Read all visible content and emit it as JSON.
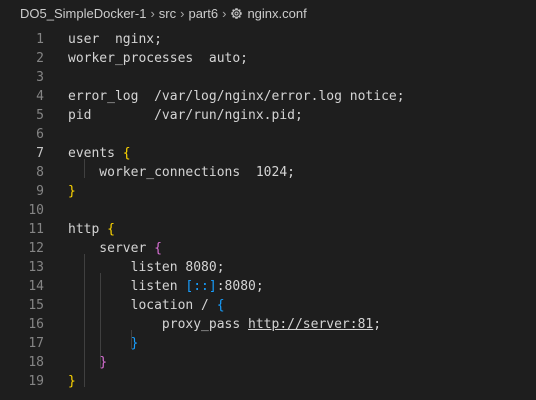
{
  "breadcrumb": {
    "items": [
      "DO5_SimpleDocker-1",
      "src",
      "part6"
    ],
    "file_name": "nginx.conf",
    "file_icon": "gear-icon",
    "separator_icon": "chevron-right-icon"
  },
  "editor": {
    "active_line": 7,
    "colors": {
      "background": "#1e1e1e",
      "text": "#d4d4d4",
      "line_number": "#858585",
      "brace_gold": "#ffd700",
      "brace_pink": "#da70d6",
      "brace_blue": "#179fff"
    },
    "lines": [
      {
        "n": "1",
        "text": "user  nginx;"
      },
      {
        "n": "2",
        "text": "worker_processes  auto;"
      },
      {
        "n": "3",
        "text": ""
      },
      {
        "n": "4",
        "text": "error_log  /var/log/nginx/error.log notice;"
      },
      {
        "n": "5",
        "text": "pid        /var/run/nginx.pid;"
      },
      {
        "n": "6",
        "text": ""
      },
      {
        "n": "7",
        "pre": "events ",
        "brace": "{"
      },
      {
        "n": "8",
        "text": "    worker_connections  1024;"
      },
      {
        "n": "9",
        "brace": "}"
      },
      {
        "n": "10",
        "text": ""
      },
      {
        "n": "11",
        "pre": "http ",
        "brace": "{"
      },
      {
        "n": "12",
        "pre": "    server ",
        "brace": "{"
      },
      {
        "n": "13",
        "text": "        listen 8080;"
      },
      {
        "n": "14",
        "pre": "        listen ",
        "bracket": "[::]",
        "post": ":8080;"
      },
      {
        "n": "15",
        "pre": "        location / ",
        "brace": "{"
      },
      {
        "n": "16",
        "pre": "            proxy_pass ",
        "link": "http://server:81",
        "post": ";"
      },
      {
        "n": "17",
        "pre": "        ",
        "brace": "}"
      },
      {
        "n": "18",
        "pre": "    ",
        "brace": "}"
      },
      {
        "n": "19",
        "brace": "}"
      }
    ]
  }
}
